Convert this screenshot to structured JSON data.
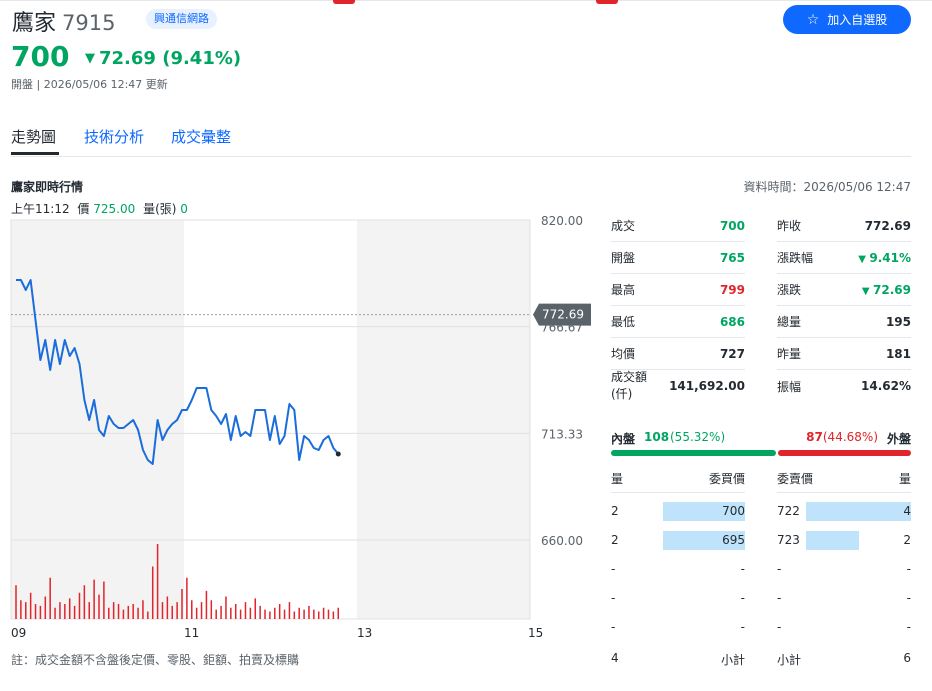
{
  "stock": {
    "name": "鷹家",
    "code": "7915",
    "industry": "興通信網路",
    "price": "700",
    "change": "72.69",
    "change_pct": "(9.41%)",
    "status": "開盤 | 2026/05/06 12:47 更新",
    "watch_label": "加入自選股"
  },
  "tabs": [
    "走勢圖",
    "技術分析",
    "成交彙整"
  ],
  "section": {
    "title": "鷹家即時行情",
    "data_time": "資料時間：2026/05/06 12:47"
  },
  "tooltip": {
    "time": "上午11:12",
    "price_label": "價",
    "price": "725.00",
    "volume_label": "量(張)",
    "volume": "0"
  },
  "chart_data": {
    "type": "line",
    "x_labels": [
      "09",
      "11",
      "13",
      "15"
    ],
    "y_ticks": [
      "820.00",
      "766.67",
      "713.33",
      "660.00"
    ],
    "ylim": [
      660,
      820
    ],
    "reference_price": "772.69",
    "prices": [
      790,
      790,
      785,
      790,
      770,
      750,
      760,
      745,
      760,
      748,
      760,
      752,
      756,
      748,
      730,
      720,
      730,
      715,
      712,
      722,
      718,
      716,
      716,
      718,
      720,
      715,
      705,
      700,
      698,
      720,
      710,
      715,
      718,
      720,
      725,
      725,
      730,
      736,
      736,
      736,
      725,
      722,
      718,
      723,
      710,
      722,
      712,
      714,
      712,
      725,
      725,
      725,
      710,
      722,
      708,
      712,
      728,
      725,
      700,
      712,
      710,
      706,
      705,
      710,
      712,
      706,
      703
    ],
    "volumes": [
      18,
      10,
      9,
      14,
      8,
      7,
      12,
      22,
      6,
      9,
      8,
      11,
      7,
      14,
      18,
      9,
      21,
      13,
      20,
      6,
      9,
      8,
      5,
      7,
      8,
      6,
      10,
      4,
      28,
      40,
      9,
      12,
      7,
      9,
      16,
      22,
      10,
      6,
      9,
      15,
      10,
      5,
      7,
      12,
      6,
      8,
      5,
      9,
      6,
      11,
      7,
      5,
      4,
      6,
      8,
      5,
      9,
      4,
      6,
      5,
      7,
      5,
      4,
      6,
      5,
      4,
      6
    ],
    "color": "#1a6ddb"
  },
  "stats_left": [
    {
      "label": "成交",
      "value": "700",
      "color": "green"
    },
    {
      "label": "開盤",
      "value": "765",
      "color": "green"
    },
    {
      "label": "最高",
      "value": "799",
      "color": "red"
    },
    {
      "label": "最低",
      "value": "686",
      "color": "green"
    },
    {
      "label": "均價",
      "value": "727",
      "color": ""
    },
    {
      "label": "成交額(仟)",
      "value": "141,692.00",
      "color": ""
    }
  ],
  "stats_right": [
    {
      "label": "昨收",
      "value": "772.69",
      "color": ""
    },
    {
      "label": "漲跌幅",
      "value": "9.41%",
      "color": "green",
      "tri": true
    },
    {
      "label": "漲跌",
      "value": "72.69",
      "color": "green",
      "tri": true
    },
    {
      "label": "總量",
      "value": "195",
      "color": ""
    },
    {
      "label": "昨量",
      "value": "181",
      "color": ""
    },
    {
      "label": "振幅",
      "value": "14.62%",
      "color": ""
    }
  ],
  "inner_outer": {
    "inner_label": "內盤",
    "inner_value": "108",
    "inner_pct": "(55.32%)",
    "outer_value": "87",
    "outer_pct": "(44.68%)",
    "outer_label": "外盤",
    "inner_ratio": 0.5532
  },
  "orderbook": {
    "headers": [
      "量",
      "委買價",
      "委賣價",
      "量"
    ],
    "bids": [
      {
        "qty": "2",
        "price": "700",
        "ratio": 1.0
      },
      {
        "qty": "2",
        "price": "695",
        "ratio": 1.0
      },
      {
        "qty": "-",
        "price": "-",
        "ratio": 0
      },
      {
        "qty": "-",
        "price": "-",
        "ratio": 0
      },
      {
        "qty": "-",
        "price": "-",
        "ratio": 0
      }
    ],
    "asks": [
      {
        "price": "722",
        "qty": "4",
        "ratio": 1.0
      },
      {
        "price": "723",
        "qty": "2",
        "ratio": 0.5
      },
      {
        "price": "-",
        "qty": "-",
        "ratio": 0
      },
      {
        "price": "-",
        "qty": "-",
        "ratio": 0
      },
      {
        "price": "-",
        "qty": "-",
        "ratio": 0
      }
    ],
    "bid_total": "4",
    "subtotal_label": "小計",
    "ask_total": "6"
  },
  "footnote": "註：成交金額不含盤後定價、零股、鉅額、拍賣及標購",
  "colors": {
    "green": "#00a562",
    "red": "#e0252b",
    "accent": "#0f69ff"
  }
}
